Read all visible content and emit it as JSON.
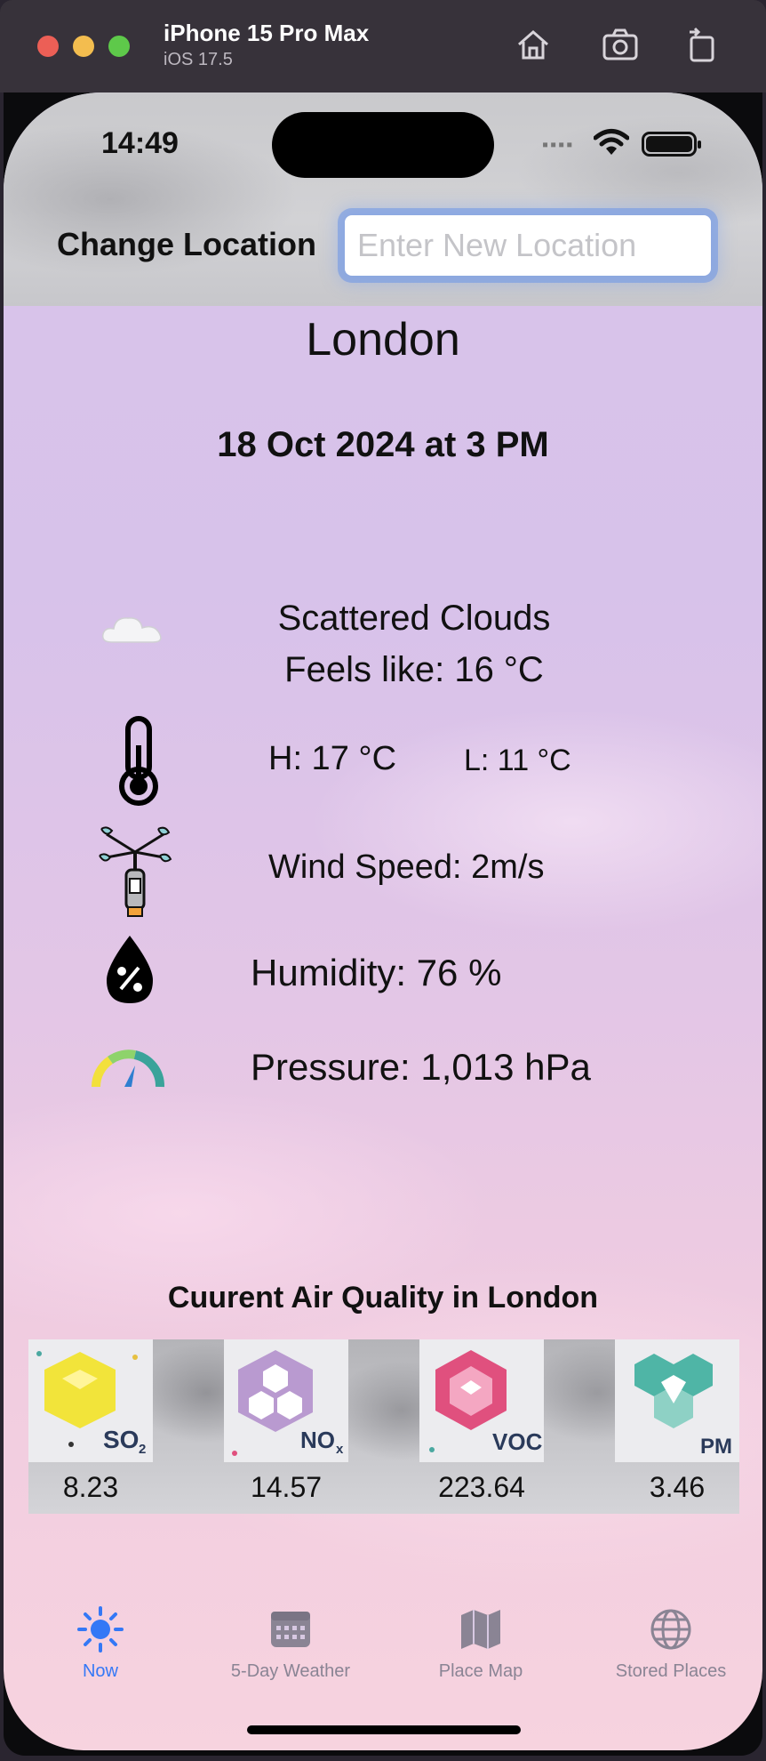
{
  "simulator": {
    "device_name": "iPhone 15 Pro Max",
    "os_version": "iOS 17.5",
    "buttons": [
      "home-icon",
      "screenshot-icon",
      "rotate-icon"
    ]
  },
  "status_bar": {
    "time": "14:49",
    "signal_dots": "▪▪▪▪"
  },
  "location": {
    "label": "Change Location",
    "placeholder": "Enter New Location",
    "value": ""
  },
  "current": {
    "city": "London",
    "datetime": "18 Oct 2024 at 3 PM",
    "condition": "Scattered Clouds",
    "feels_like": "Feels like: 16 °C",
    "high": "H: 17 °C",
    "low": "L: 11 °C",
    "wind": "Wind Speed: 2m/s",
    "humidity": "Humidity: 76 %",
    "pressure": "Pressure: 1,013 hPa"
  },
  "air_quality": {
    "title": "Cuurent Air Quality in London",
    "items": [
      {
        "icon": "so2-icon",
        "value": "8.23",
        "color": "#f2e43a"
      },
      {
        "icon": "nox-icon",
        "value": "14.57",
        "color": "#b99ad0"
      },
      {
        "icon": "voc-icon",
        "value": "223.64",
        "color": "#e0507e"
      },
      {
        "icon": "pm-icon",
        "value": "3.46",
        "color": "#4fb5a6"
      }
    ]
  },
  "tabs": [
    {
      "label": "Now",
      "icon": "sun-icon",
      "active": true
    },
    {
      "label": "5-Day Weather",
      "icon": "calendar-icon",
      "active": false
    },
    {
      "label": "Place Map",
      "icon": "map-icon",
      "active": false
    },
    {
      "label": "Stored Places",
      "icon": "globe-icon",
      "active": false
    }
  ],
  "colors": {
    "accent": "#3478f6",
    "inactive_tab": "#8a8494"
  }
}
